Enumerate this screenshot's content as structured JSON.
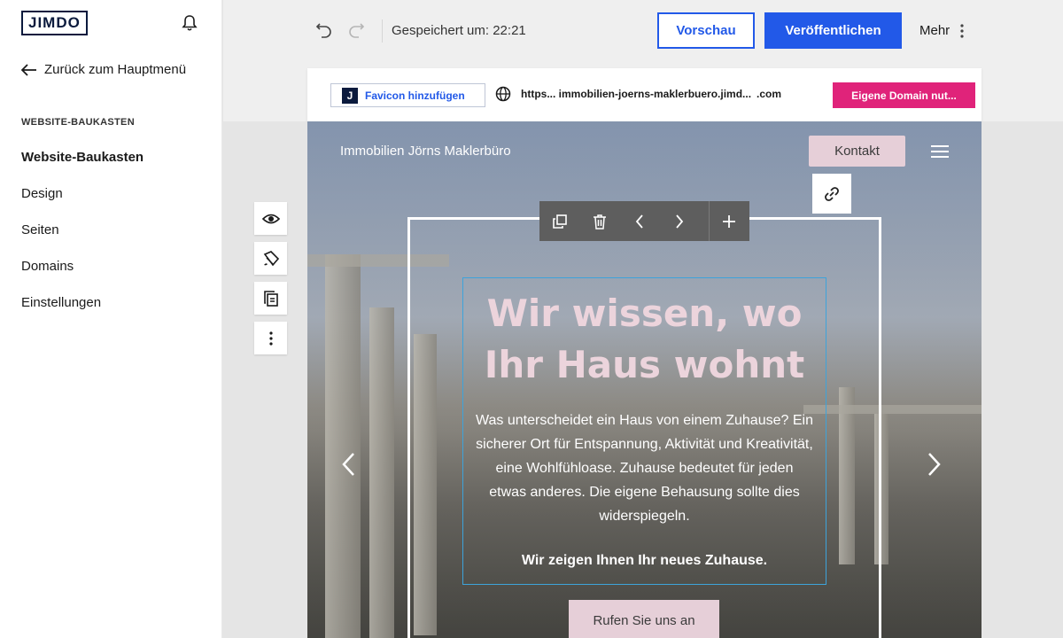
{
  "sidebar": {
    "logo": "JIMDO",
    "back_label": "Zurück zum Hauptmenü",
    "section_label": "WEBSITE-BAUKASTEN",
    "items": [
      {
        "label": "Website-Baukasten",
        "active": true
      },
      {
        "label": "Design"
      },
      {
        "label": "Seiten"
      },
      {
        "label": "Domains"
      },
      {
        "label": "Einstellungen"
      }
    ]
  },
  "toolbar": {
    "saved_text": "Gespeichert um: 22:21",
    "preview_label": "Vorschau",
    "publish_label": "Veröffentlichen",
    "more_label": "Mehr"
  },
  "frame": {
    "favicon_letter": "J",
    "favicon_label": "Favicon hinzufügen",
    "url_text": "https... immobilien-joerns-maklerbuero.jimd...",
    "url_tld": ".com",
    "domain_button": "Eigene Domain nut..."
  },
  "site": {
    "name": "Immobilien Jörns Maklerbüro",
    "contact_label": "Kontakt",
    "hero_title": "Wir wissen, wo Ihr Haus wohnt",
    "hero_text": "Was unterscheidet ein Haus von einem Zuhause? Ein sicherer Ort für Entspannung, Aktivität und Kreativität, eine Wohlfühloase. Zuhause bedeutet für jeden etwas anderes. Die eigene Behausung sollte dies widerspiegeln.",
    "hero_strong": "Wir zeigen Ihnen Ihr neues Zuhause.",
    "cta_label": "Rufen Sie uns an"
  },
  "colors": {
    "primary": "#2259e8",
    "accent_pink": "#e0237a",
    "logo_navy": "#0b1a3d",
    "button_pink_light": "#e6cfd8",
    "selection_blue": "#3da3db"
  },
  "icons": [
    "bell-icon",
    "arrow-left-icon",
    "undo-icon",
    "redo-icon",
    "more-vertical-icon",
    "globe-icon",
    "menu-icon",
    "link-icon",
    "duplicate-icon",
    "trash-icon",
    "chevron-left-icon",
    "chevron-right-icon",
    "plus-icon",
    "eye-icon",
    "brush-icon",
    "copy-page-icon"
  ]
}
